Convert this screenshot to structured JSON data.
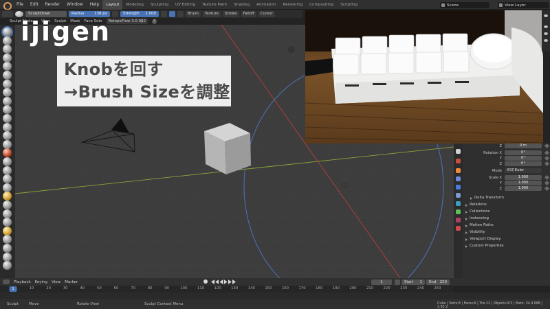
{
  "menu": {
    "items": [
      "File",
      "Edit",
      "Render",
      "Window",
      "Help"
    ]
  },
  "workspaces": [
    "Layout",
    "Modeling",
    "Sculpting",
    "UV Editing",
    "Texture Paint",
    "Shading",
    "Animation",
    "Rendering",
    "Compositing",
    "Scripting"
  ],
  "workspace_active": "Layout",
  "scene": {
    "label": "Scene"
  },
  "view_layer": {
    "label": "View Layer"
  },
  "tool_header": {
    "mode": "Sculpt Mode",
    "brush_name": "SculptDraw",
    "radius_label": "Radius",
    "radius_value": "138 px",
    "strength_label": "Strength",
    "strength_value": "1.000",
    "menus": [
      "Brush",
      "Texture",
      "Stroke",
      "Falloff",
      "Cursor"
    ]
  },
  "sub_header": {
    "items": [
      "View",
      "Sculpt",
      "Mask",
      "Face Sets"
    ],
    "retopo": "RetopoFlow 3.0.0β2",
    "help": "?"
  },
  "overlay": {
    "line1": "Knobを回す",
    "line2": "→Brush Sizeを調整"
  },
  "brand": {
    "text": "ijigen"
  },
  "properties": {
    "location_z_label": "Z",
    "location_z_value": "0 m",
    "rotation_label": "Rotation X",
    "rotation_x": "0°",
    "rotation_y_label": "Y",
    "rotation_y": "0°",
    "rotation_z_label": "Z",
    "rotation_z": "0°",
    "mode_label": "Mode",
    "mode_value": "XYZ Euler",
    "scale_label": "Scale X",
    "scale_x": "1.000",
    "scale_y_label": "Y",
    "scale_y": "1.000",
    "scale_z_label": "Z",
    "scale_z": "1.000",
    "sections": [
      "Delta Transform",
      "Relations",
      "Collections",
      "Instancing",
      "Motion Paths",
      "Visibility",
      "Viewport Display",
      "Custom Properties"
    ]
  },
  "timeline": {
    "menus": [
      "Playback",
      "Keying",
      "View",
      "Marker"
    ],
    "current_frame": "1",
    "start_label": "Start",
    "start_value": "1",
    "end_label": "End",
    "end_value": "250",
    "ruler_current": "1",
    "ruler_ticks": [
      "10",
      "20",
      "30",
      "40",
      "50",
      "60",
      "70",
      "80",
      "90",
      "100",
      "110",
      "120",
      "130",
      "140",
      "150",
      "160",
      "170",
      "180",
      "190",
      "200",
      "210",
      "220",
      "230",
      "240",
      "250"
    ]
  },
  "status_bar": {
    "left": "Sculpt",
    "move": "Move",
    "rotate": "Rotate View",
    "context": "Sculpt Context Menu",
    "stats": "Cube | Verts:8 | Faces:6 | Tris:12 | Objects:0/3 | Mem: 34.4 MiB | 2.83.2"
  },
  "colors": {
    "accent": "#4772b3",
    "viewport_bg": "#3d3d3d",
    "x_axis": "#b8403a",
    "y_axis": "#8aa63a",
    "camera_line": "#101010"
  }
}
